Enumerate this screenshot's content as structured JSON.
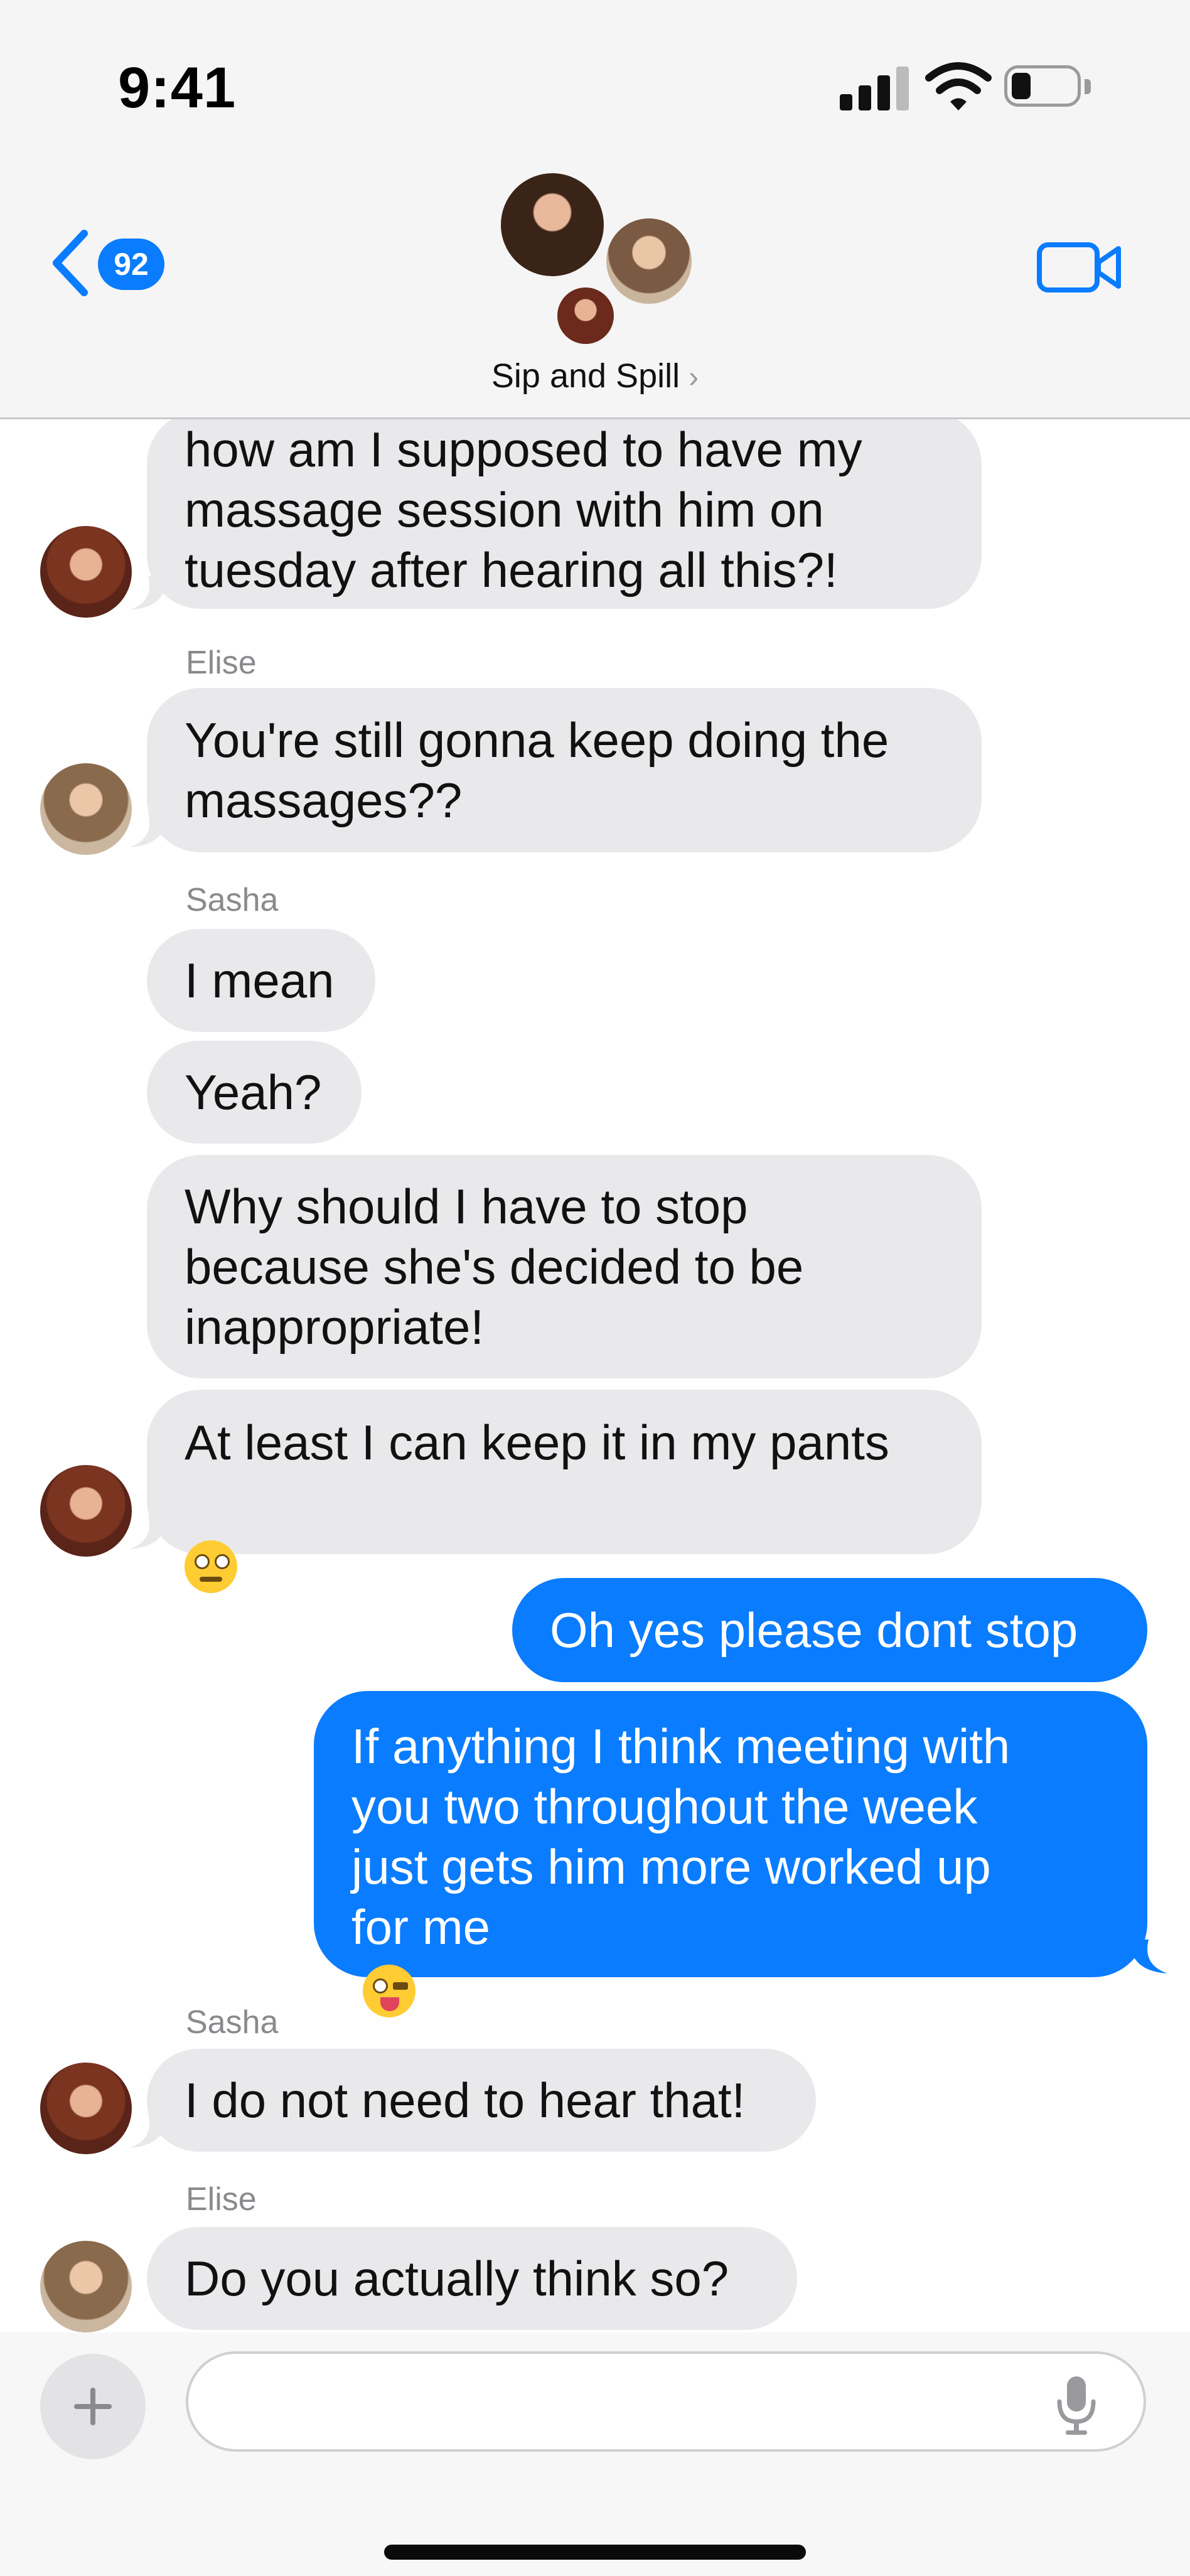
{
  "status_bar": {
    "time": "9:41"
  },
  "header": {
    "back_badge": "92",
    "group_name": "Sip and Spill",
    "chevron": "›"
  },
  "messages": [
    {
      "dir": "in",
      "avatar": "sasha",
      "text": "how am I supposed to have my massage session with him on tuesday after hearing all this?!"
    },
    {
      "sender": "Elise"
    },
    {
      "dir": "in",
      "avatar": "elise",
      "text": "You're still gonna keep doing the massages??"
    },
    {
      "sender": "Sasha"
    },
    {
      "dir": "in",
      "text": "I mean"
    },
    {
      "dir": "in",
      "text": "Yeah?"
    },
    {
      "dir": "in",
      "text": "Why should I have to stop because she's decided to be inappropriate!"
    },
    {
      "dir": "in",
      "avatar": "sasha",
      "text": "At least I can keep it in my pants",
      "emoji": "eye-roll-emoji"
    },
    {
      "dir": "out",
      "text": "Oh yes please dont stop"
    },
    {
      "dir": "out",
      "text": "If anything I think meeting with you two throughout the week just gets him more worked up for me",
      "emoji": "winking-tongue-emoji"
    },
    {
      "sender": "Sasha"
    },
    {
      "dir": "in",
      "avatar": "sasha",
      "text": "I do not need to hear that!"
    },
    {
      "sender": "Elise"
    },
    {
      "dir": "in",
      "avatar": "elise",
      "text": "Do you actually think so?"
    }
  ],
  "thread": {
    "m1": "how am I supposed to have my\nmassage session with him on\ntuesday after hearing all this?!",
    "s_elise_1": "Elise",
    "m2": "You're still gonna keep doing the\nmassages??",
    "s_sasha_1": "Sasha",
    "m3": "I mean",
    "m4": "Yeah?",
    "m5": "Why should I have to stop\nbecause she's decided to be\ninappropriate!",
    "m6": "At least I can keep it in my pants",
    "m7": "Oh yes please dont stop",
    "m8": "If anything I think meeting with\nyou two throughout the week\njust gets him more worked up\nfor me",
    "s_sasha_2": "Sasha",
    "m9": "I do not need to hear that!",
    "s_elise_2": "Elise",
    "m10": "Do you actually think so?"
  },
  "composer": {
    "value": "",
    "placeholder": ""
  },
  "colors": {
    "accent": "#0a7cff",
    "incoming_bubble": "#e9e9eb",
    "sender_label": "#8a8a8e"
  },
  "icons": [
    "back-chevron-icon",
    "video-camera-icon",
    "plus-icon",
    "microphone-icon",
    "signal-icon",
    "wifi-icon",
    "battery-icon"
  ]
}
